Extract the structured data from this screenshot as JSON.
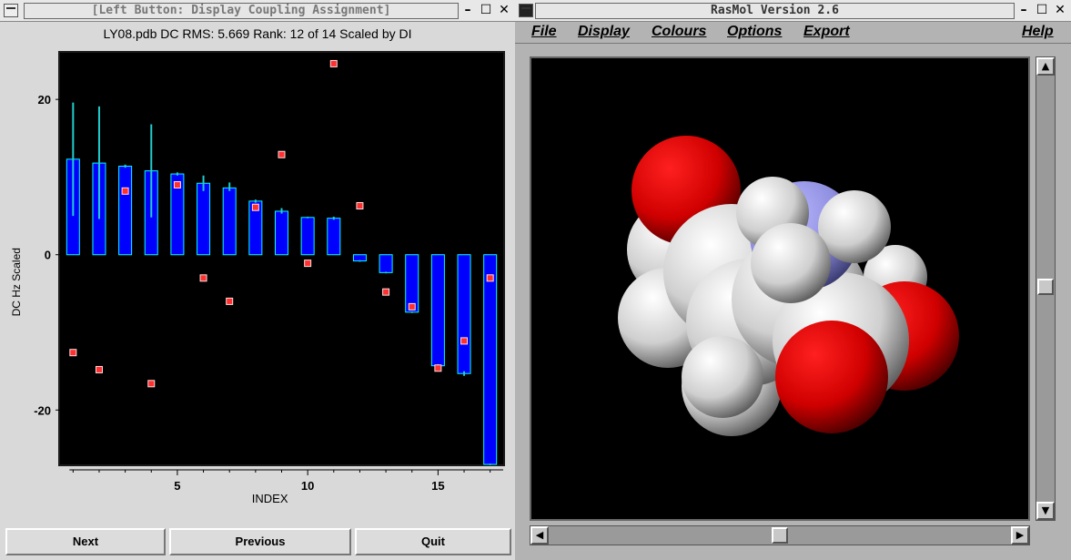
{
  "left_window": {
    "title": "[Left Button: Display Coupling Assignment]",
    "subtitle": "LY08.pdb DC RMS: 5.669 Rank: 12 of 14 Scaled by DI",
    "buttons": {
      "next": "Next",
      "previous": "Previous",
      "quit": "Quit"
    },
    "window_controls": {
      "minimize": "–",
      "maximize": "☐",
      "close": "✕"
    }
  },
  "right_window": {
    "title": "RasMol Version 2.6",
    "menu": [
      "File",
      "Display",
      "Colours",
      "Options",
      "Export",
      "Help"
    ],
    "window_controls": {
      "minimize": "–",
      "maximize": "☐",
      "close": "✕"
    }
  },
  "chart_data": {
    "type": "bar",
    "title": "",
    "xlabel": "INDEX",
    "ylabel": "DC Hz Scaled",
    "xlim": [
      0.5,
      17.5
    ],
    "ylim": [
      -27,
      26
    ],
    "x_ticks": [
      5,
      10,
      15
    ],
    "y_ticks": [
      20,
      0,
      -20
    ],
    "x": [
      1,
      2,
      3,
      4,
      5,
      6,
      7,
      8,
      9,
      10,
      11,
      12,
      13,
      14,
      15,
      16,
      17
    ],
    "series": [
      {
        "kind": "bar",
        "values": [
          12.3,
          11.8,
          11.4,
          10.8,
          10.4,
          9.2,
          8.6,
          6.9,
          5.6,
          4.8,
          4.7,
          -0.8,
          -2.3,
          -7.4,
          -14.3,
          -15.3,
          -27.0
        ]
      },
      {
        "kind": "error",
        "ranges": [
          [
            5.0,
            19.6
          ],
          [
            4.6,
            19.1
          ],
          [
            11.2,
            11.6
          ],
          [
            4.8,
            16.8
          ],
          [
            10.2,
            10.6
          ],
          [
            8.2,
            10.2
          ],
          [
            8.2,
            9.3
          ],
          [
            6.7,
            7.1
          ],
          [
            5.3,
            6.0
          ],
          [
            4.7,
            4.9
          ],
          [
            4.5,
            4.9
          ],
          [
            -0.9,
            -0.7
          ],
          [
            -2.4,
            -2.2
          ],
          [
            -7.5,
            -7.3
          ],
          [
            -14.5,
            -14.1
          ],
          [
            -15.6,
            -15.0
          ],
          [
            -27.1,
            -26.9
          ]
        ]
      },
      {
        "kind": "points",
        "values": [
          -12.6,
          -14.8,
          8.2,
          -16.6,
          9.0,
          -3.0,
          -6.0,
          6.1,
          12.9,
          -1.1,
          24.6,
          6.3,
          -4.8,
          -6.7,
          -14.6,
          -11.1,
          -3.0
        ]
      }
    ],
    "colors": {
      "bar_fill": "#0000ff",
      "bar_edge": "#00ffff",
      "error": "#22cccc",
      "point": "#ff3030",
      "background": "#000000"
    }
  }
}
